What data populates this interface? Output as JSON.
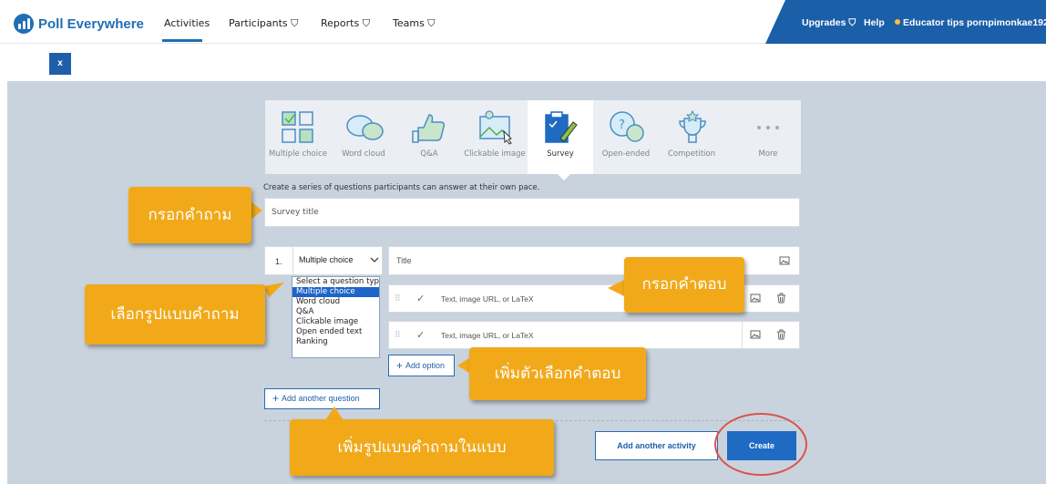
{
  "brand": {
    "name": "Poll Everywhere",
    "color": "#1f6fb5"
  },
  "nav": {
    "activities": "Activities",
    "participants": "Participants ⛉",
    "reports": "Reports ⛉",
    "teams": "Teams ⛉",
    "upgrades": "Upgrades ⛉",
    "help": "Help",
    "tips": "Educator tips",
    "user": "pornpimonkae192 ⚙"
  },
  "close_label": "x",
  "activity_types": [
    {
      "label": "Multiple choice",
      "icon": "multiple-choice-icon"
    },
    {
      "label": "Word cloud",
      "icon": "word-cloud-icon"
    },
    {
      "label": "Q&A",
      "icon": "qa-icon"
    },
    {
      "label": "Clickable image",
      "icon": "clickable-image-icon"
    },
    {
      "label": "Survey",
      "icon": "survey-icon",
      "active": true
    },
    {
      "label": "Open-ended",
      "icon": "open-ended-icon"
    },
    {
      "label": "Competition",
      "icon": "competition-icon"
    },
    {
      "label": "More",
      "icon": "more-icon"
    }
  ],
  "helper_text": "Create a series of questions participants can answer at their own pace.",
  "survey_title_placeholder": "Survey title",
  "question": {
    "number": "1.",
    "type": "Multiple choice",
    "title_placeholder": "Title"
  },
  "type_dropdown": {
    "options": [
      "Select a question type",
      "Multiple choice",
      "Word cloud",
      "Q&A",
      "Clickable image",
      "Open ended text",
      "Ranking"
    ],
    "highlighted": "Multiple choice"
  },
  "options": [
    {
      "placeholder": "Text, image URL, or LaTeX"
    },
    {
      "placeholder": "Text, image URL, or LaTeX"
    }
  ],
  "buttons": {
    "add_option": "Add option",
    "add_question": "Add another question",
    "add_activity": "Add another activity",
    "create": "Create"
  },
  "callouts": {
    "question": "กรอกคำถาม",
    "type": "เลือกรูปแบบคำถาม",
    "answer": "กรอกคำตอบ",
    "add_option": "เพิ่มตัวเลือกคำตอบ",
    "add_question": "เพิ่มรูปแบบคำถามในแบบ"
  },
  "colors": {
    "accent": "#1f6ac2",
    "callout": "#f1a91a",
    "highlight_circle": "#d9534f"
  }
}
